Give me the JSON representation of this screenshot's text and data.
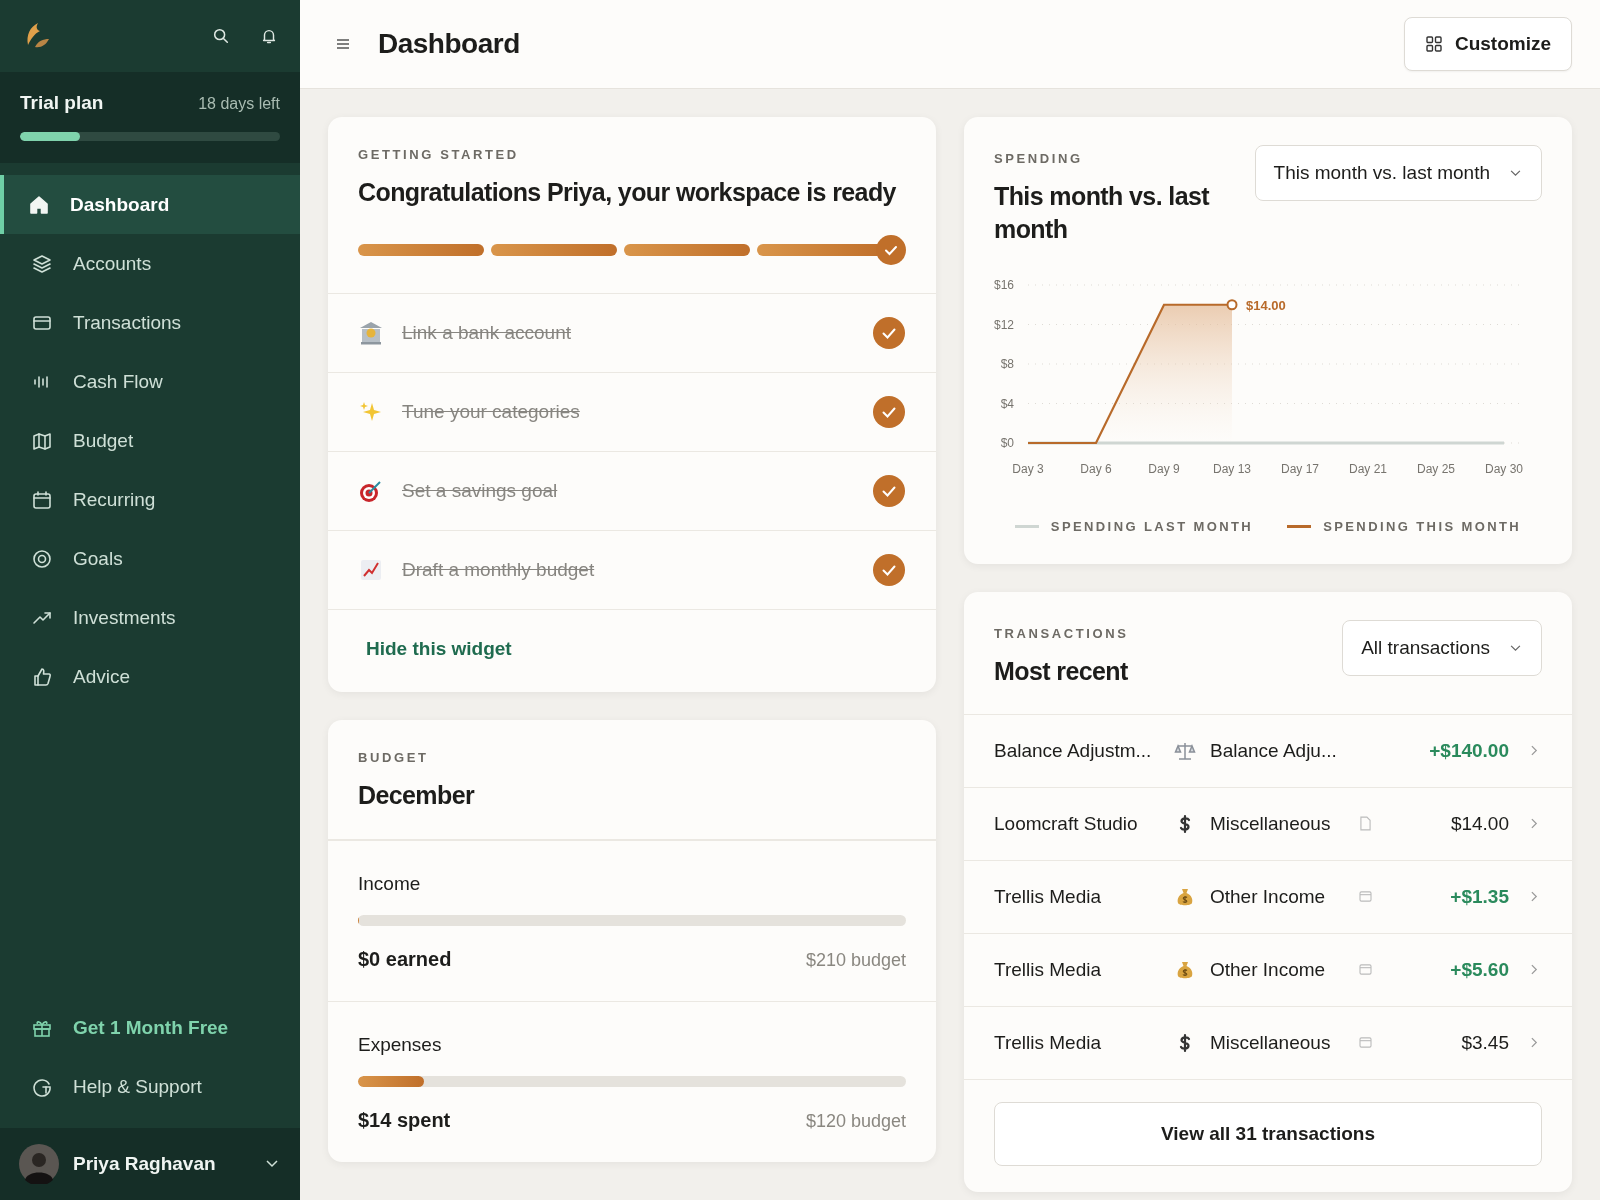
{
  "sidebar": {
    "trial": {
      "label": "Trial plan",
      "remaining": "18 days left",
      "level": 0.23
    },
    "items": [
      {
        "label": "Dashboard",
        "selected": true
      },
      {
        "label": "Accounts",
        "selected": false
      },
      {
        "label": "Transactions",
        "selected": false
      },
      {
        "label": "Cash Flow",
        "selected": false
      },
      {
        "label": "Budget",
        "selected": false
      },
      {
        "label": "Recurring",
        "selected": false
      },
      {
        "label": "Goals",
        "selected": false
      },
      {
        "label": "Investments",
        "selected": false
      },
      {
        "label": "Advice",
        "selected": false
      }
    ],
    "promo": "Get 1 Month Free",
    "help": "Help & Support",
    "user": "Priya Raghavan"
  },
  "header": {
    "title": "Dashboard",
    "button": "Customize"
  },
  "getting_started": {
    "eyebrow": "GETTING STARTED",
    "title": "Congratulations Priya, your workspace is ready",
    "tasks": [
      {
        "label": "Link a bank account",
        "checked": true
      },
      {
        "label": "Tune your categories",
        "checked": true
      },
      {
        "label": "Set a savings goal",
        "checked": true
      },
      {
        "label": "Draft a monthly budget",
        "checked": true
      }
    ],
    "link": "Hide this widget"
  },
  "budget": {
    "eyebrow": "BUDGET",
    "title": "December",
    "lines": [
      {
        "label": "Income",
        "level": 0,
        "amount": "$0 earned",
        "budget": "$210 budget"
      },
      {
        "label": "Expenses",
        "level": 0.12,
        "amount": "$14 spent",
        "budget": "$120 budget"
      }
    ]
  },
  "spending": {
    "eyebrow": "SPENDING",
    "title": "This month vs. last month",
    "dropdown": "This month vs. last month",
    "chart_data": {
      "type": "line",
      "categories": [
        "Day 3",
        "Day 6",
        "Day 9",
        "Day 13",
        "Day 17",
        "Day 21",
        "Day 25",
        "Day 30"
      ],
      "series": [
        {
          "name": "SPENDING LAST MONTH",
          "color": "#cfd6d2",
          "values": [
            0,
            0,
            0,
            0,
            0,
            0,
            0,
            0
          ]
        },
        {
          "name": "SPENDING THIS MONTH",
          "color": "#b86a2a",
          "values": [
            0,
            0,
            14,
            14,
            null,
            null,
            null,
            null
          ]
        }
      ],
      "yticks": [
        {
          "value": 0,
          "label": "$0"
        },
        {
          "value": 4,
          "label": "$4"
        },
        {
          "value": 8,
          "label": "$8"
        },
        {
          "value": 12,
          "label": "$12"
        },
        {
          "value": 16,
          "label": "$16"
        }
      ],
      "ylim": [
        0,
        16
      ],
      "annotations": [
        "$14.00"
      ]
    }
  },
  "transactions": {
    "eyebrow": "TRANSACTIONS",
    "title": "Most recent",
    "dropdown": "All transactions",
    "rows": [
      {
        "merchant": "Balance Adjustm...",
        "category": "Balance Adju...",
        "amount": "+$140.00",
        "income": true
      },
      {
        "merchant": "Loomcraft Studio",
        "category": "Miscellaneous",
        "amount": "$14.00",
        "income": false
      },
      {
        "merchant": "Trellis Media",
        "category": "Other Income",
        "amount": "+$1.35",
        "income": true
      },
      {
        "merchant": "Trellis Media",
        "category": "Other Income",
        "amount": "+$5.60",
        "income": true
      },
      {
        "merchant": "Trellis Media",
        "category": "Miscellaneous",
        "amount": "$3.45",
        "income": false
      }
    ],
    "button": "View all 31 transactions"
  }
}
